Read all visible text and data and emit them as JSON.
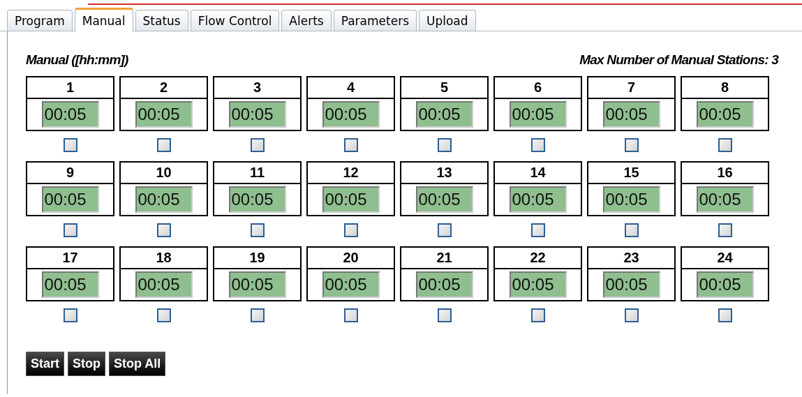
{
  "tabs": [
    {
      "label": "Program",
      "selected": false
    },
    {
      "label": "Manual",
      "selected": true
    },
    {
      "label": "Status",
      "selected": false
    },
    {
      "label": "Flow Control",
      "selected": false
    },
    {
      "label": "Alerts",
      "selected": false
    },
    {
      "label": "Parameters",
      "selected": false
    },
    {
      "label": "Upload",
      "selected": false
    }
  ],
  "heading": "Manual ([hh:mm])",
  "max_stations": "Max Number of Manual Stations: 3",
  "stations": [
    {
      "label": "1",
      "value": "00:05",
      "checked": false
    },
    {
      "label": "2",
      "value": "00:05",
      "checked": false
    },
    {
      "label": "3",
      "value": "00:05",
      "checked": false
    },
    {
      "label": "4",
      "value": "00:05",
      "checked": false
    },
    {
      "label": "5",
      "value": "00:05",
      "checked": false
    },
    {
      "label": "6",
      "value": "00:05",
      "checked": false
    },
    {
      "label": "7",
      "value": "00:05",
      "checked": false
    },
    {
      "label": "8",
      "value": "00:05",
      "checked": false
    },
    {
      "label": "9",
      "value": "00:05",
      "checked": false
    },
    {
      "label": "10",
      "value": "00:05",
      "checked": false
    },
    {
      "label": "11",
      "value": "00:05",
      "checked": false
    },
    {
      "label": "12",
      "value": "00:05",
      "checked": false
    },
    {
      "label": "13",
      "value": "00:05",
      "checked": false
    },
    {
      "label": "14",
      "value": "00:05",
      "checked": false
    },
    {
      "label": "15",
      "value": "00:05",
      "checked": false
    },
    {
      "label": "16",
      "value": "00:05",
      "checked": false
    },
    {
      "label": "17",
      "value": "00:05",
      "checked": false
    },
    {
      "label": "18",
      "value": "00:05",
      "checked": false
    },
    {
      "label": "19",
      "value": "00:05",
      "checked": false
    },
    {
      "label": "20",
      "value": "00:05",
      "checked": false
    },
    {
      "label": "21",
      "value": "00:05",
      "checked": false
    },
    {
      "label": "22",
      "value": "00:05",
      "checked": false
    },
    {
      "label": "23",
      "value": "00:05",
      "checked": false
    },
    {
      "label": "24",
      "value": "00:05",
      "checked": false
    }
  ],
  "buttons": [
    "Start",
    "Stop",
    "Stop All"
  ]
}
